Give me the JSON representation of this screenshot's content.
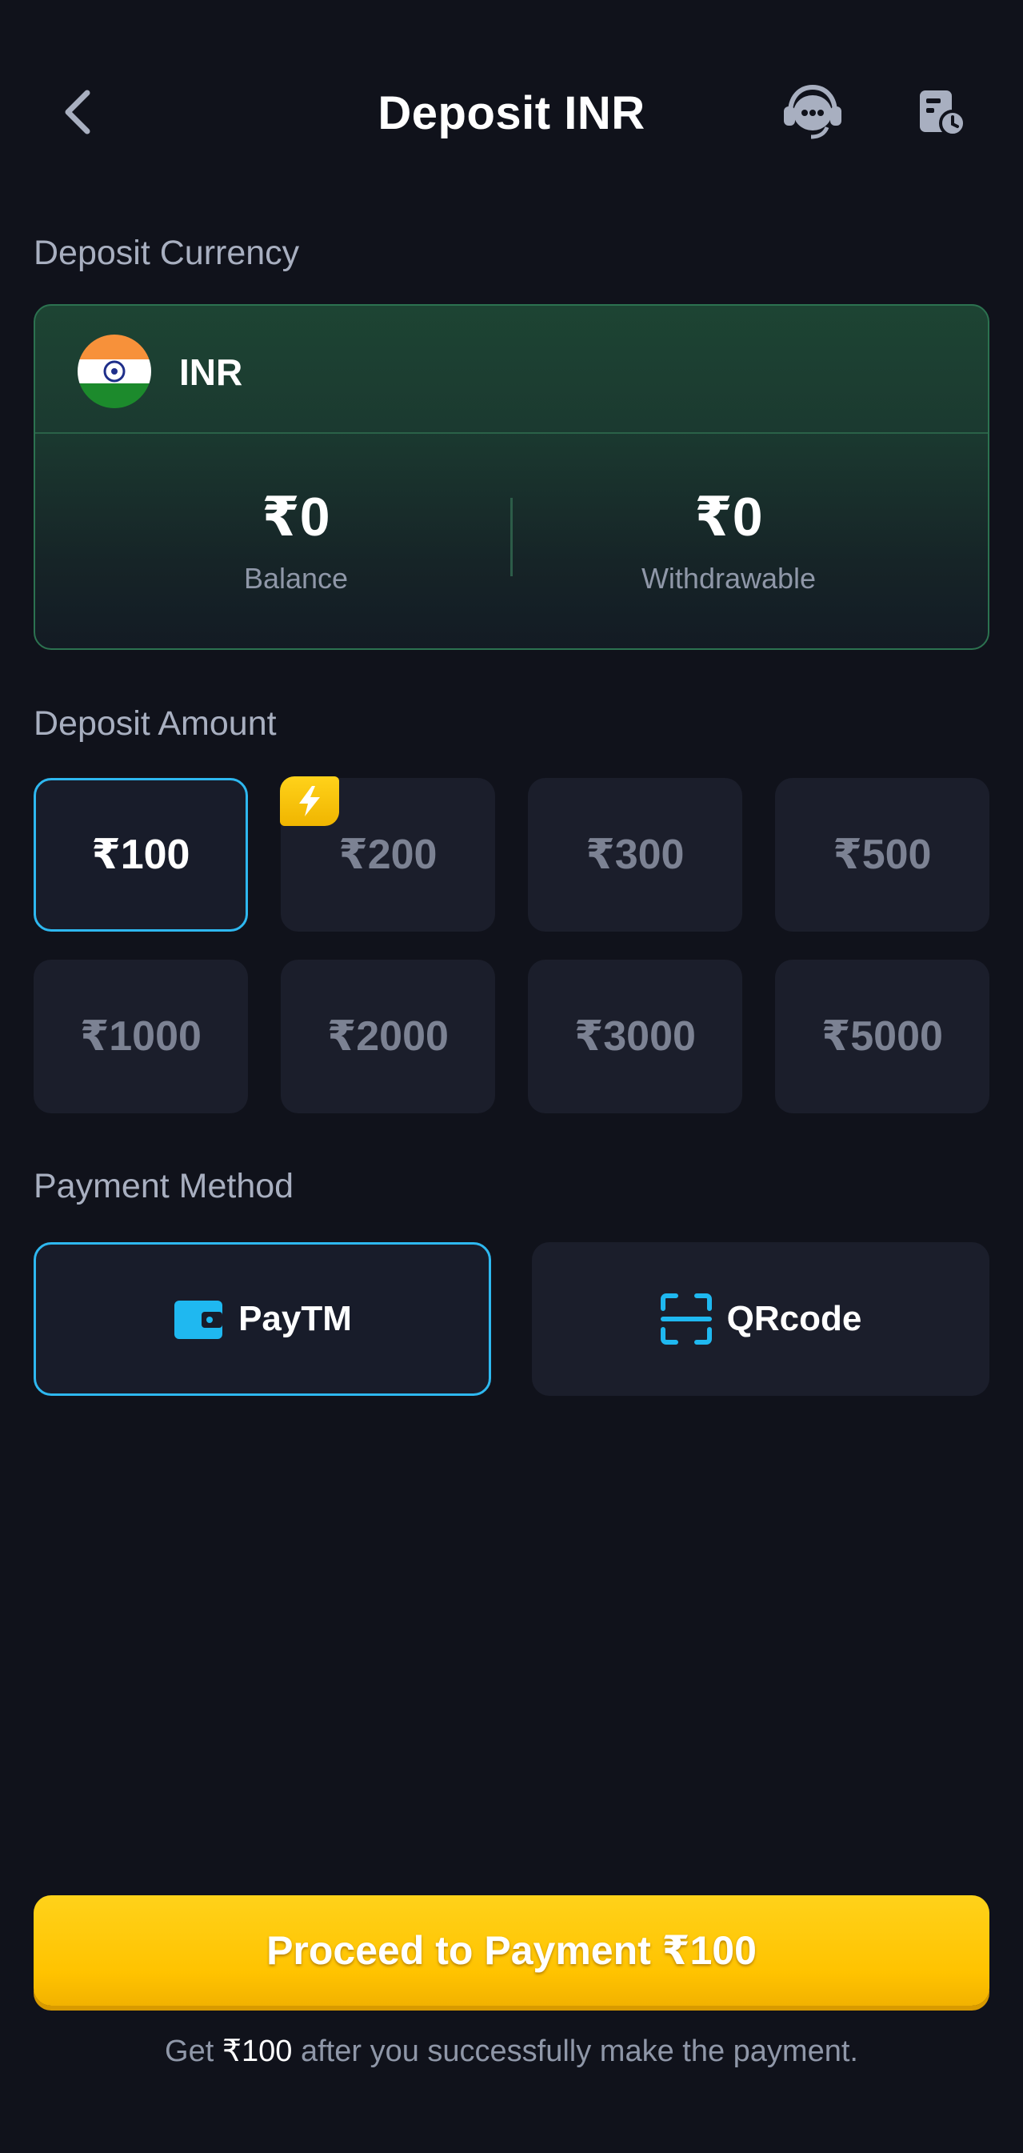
{
  "header": {
    "title": "Deposit INR"
  },
  "currency_section": {
    "label": "Deposit Currency",
    "code": "INR",
    "balance_value": "₹0",
    "balance_label": "Balance",
    "withdrawable_value": "₹0",
    "withdrawable_label": "Withdrawable"
  },
  "amount_section": {
    "label": "Deposit Amount",
    "options": [
      "₹100",
      "₹200",
      "₹300",
      "₹500",
      "₹1000",
      "₹2000",
      "₹3000",
      "₹5000"
    ],
    "selected": "₹100",
    "badge_option": "₹200"
  },
  "payment_section": {
    "label": "Payment Method",
    "methods": [
      "PayTM",
      "QRcode"
    ],
    "selected": "PayTM"
  },
  "proceed": {
    "label": "Proceed to Payment ₹100"
  },
  "footer": {
    "prefix": "Get ",
    "amount": "₹100",
    "suffix": " after you successfully make the payment."
  },
  "colors": {
    "background": "#10121b",
    "accent_blue": "#2eb8f0",
    "accent_yellow": "#ffc300",
    "card_green": "#1d4433"
  },
  "icons": {
    "back": "chevron-left-icon",
    "support": "headset-icon",
    "history": "receipt-clock-icon",
    "bolt": "lightning-icon",
    "paytm": "wallet-icon",
    "qrcode": "qr-scan-icon",
    "flag": "india-flag-icon"
  }
}
